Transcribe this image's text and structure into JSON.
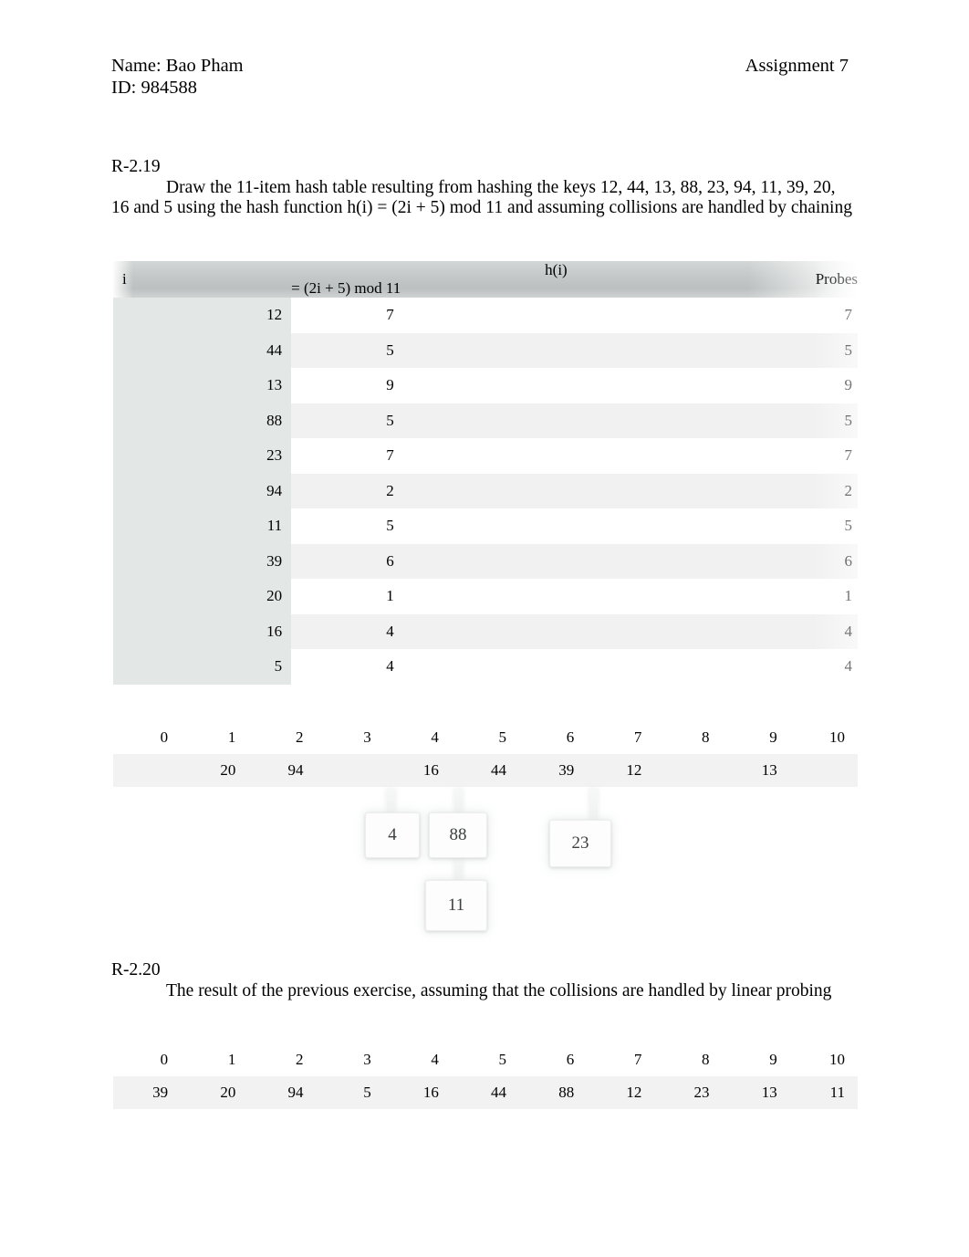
{
  "header": {
    "name_line": "Name: Bao Pham",
    "id_line": "ID: 984588",
    "assignment": "Assignment 7"
  },
  "problem_219": {
    "label": "R-2.19",
    "body": "Draw the 11-item hash table resulting from hashing the keys 12, 44, 13, 88, 23, 94, 11, 39, 20, 16 and 5 using the hash function h(i) = (2i + 5) mod 11 and assuming collisions are handled by chaining"
  },
  "problem_220": {
    "label": "R-2.20",
    "body": "The result of the previous exercise, assuming that the collisions are handled by linear probing"
  },
  "probe_table": {
    "headers": {
      "i": "i",
      "h": "h(i)   = (2i + 5) mod 11",
      "probes": "Probes"
    },
    "rows": [
      {
        "i": "12",
        "h": "7",
        "probes": "7"
      },
      {
        "i": "44",
        "h": "5",
        "probes": "5"
      },
      {
        "i": "13",
        "h": "9",
        "probes": "9"
      },
      {
        "i": "88",
        "h": "5",
        "probes": "5"
      },
      {
        "i": "23",
        "h": "7",
        "probes": "7"
      },
      {
        "i": "94",
        "h": "2",
        "probes": "2"
      },
      {
        "i": "11",
        "h": "5",
        "probes": "5"
      },
      {
        "i": "39",
        "h": "6",
        "probes": "6"
      },
      {
        "i": "20",
        "h": "1",
        "probes": "1"
      },
      {
        "i": "16",
        "h": "4",
        "probes": "4"
      },
      {
        "i": "5",
        "h": "4",
        "probes": "4"
      }
    ]
  },
  "chaining_table": {
    "indices": [
      "0",
      "1",
      "2",
      "3",
      "4",
      "5",
      "6",
      "7",
      "8",
      "9",
      "10"
    ],
    "values": [
      "",
      "20",
      "94",
      "",
      "16",
      "44",
      "39",
      "12",
      "",
      "13",
      ""
    ]
  },
  "chain_nodes": [
    {
      "label": "4",
      "slot": "4"
    },
    {
      "label": "88",
      "slot": "5"
    },
    {
      "label": "23",
      "slot": "7"
    },
    {
      "label": "11",
      "slot": "5"
    }
  ],
  "linear_probing_table": {
    "indices": [
      "0",
      "1",
      "2",
      "3",
      "4",
      "5",
      "6",
      "7",
      "8",
      "9",
      "10"
    ],
    "values": [
      "39",
      "20",
      "94",
      "5",
      "16",
      "44",
      "88",
      "12",
      "23",
      "13",
      "11"
    ]
  },
  "colors": {
    "page_background": "#ffffff",
    "table_header_gray": "#c3c7c7",
    "first_column_tint": "#e3e7e6",
    "row_stripe": "#f1f1f1",
    "slot_value_row": "#f2f2f2",
    "text": "#000000",
    "chain_node_text": "#3d4040"
  }
}
